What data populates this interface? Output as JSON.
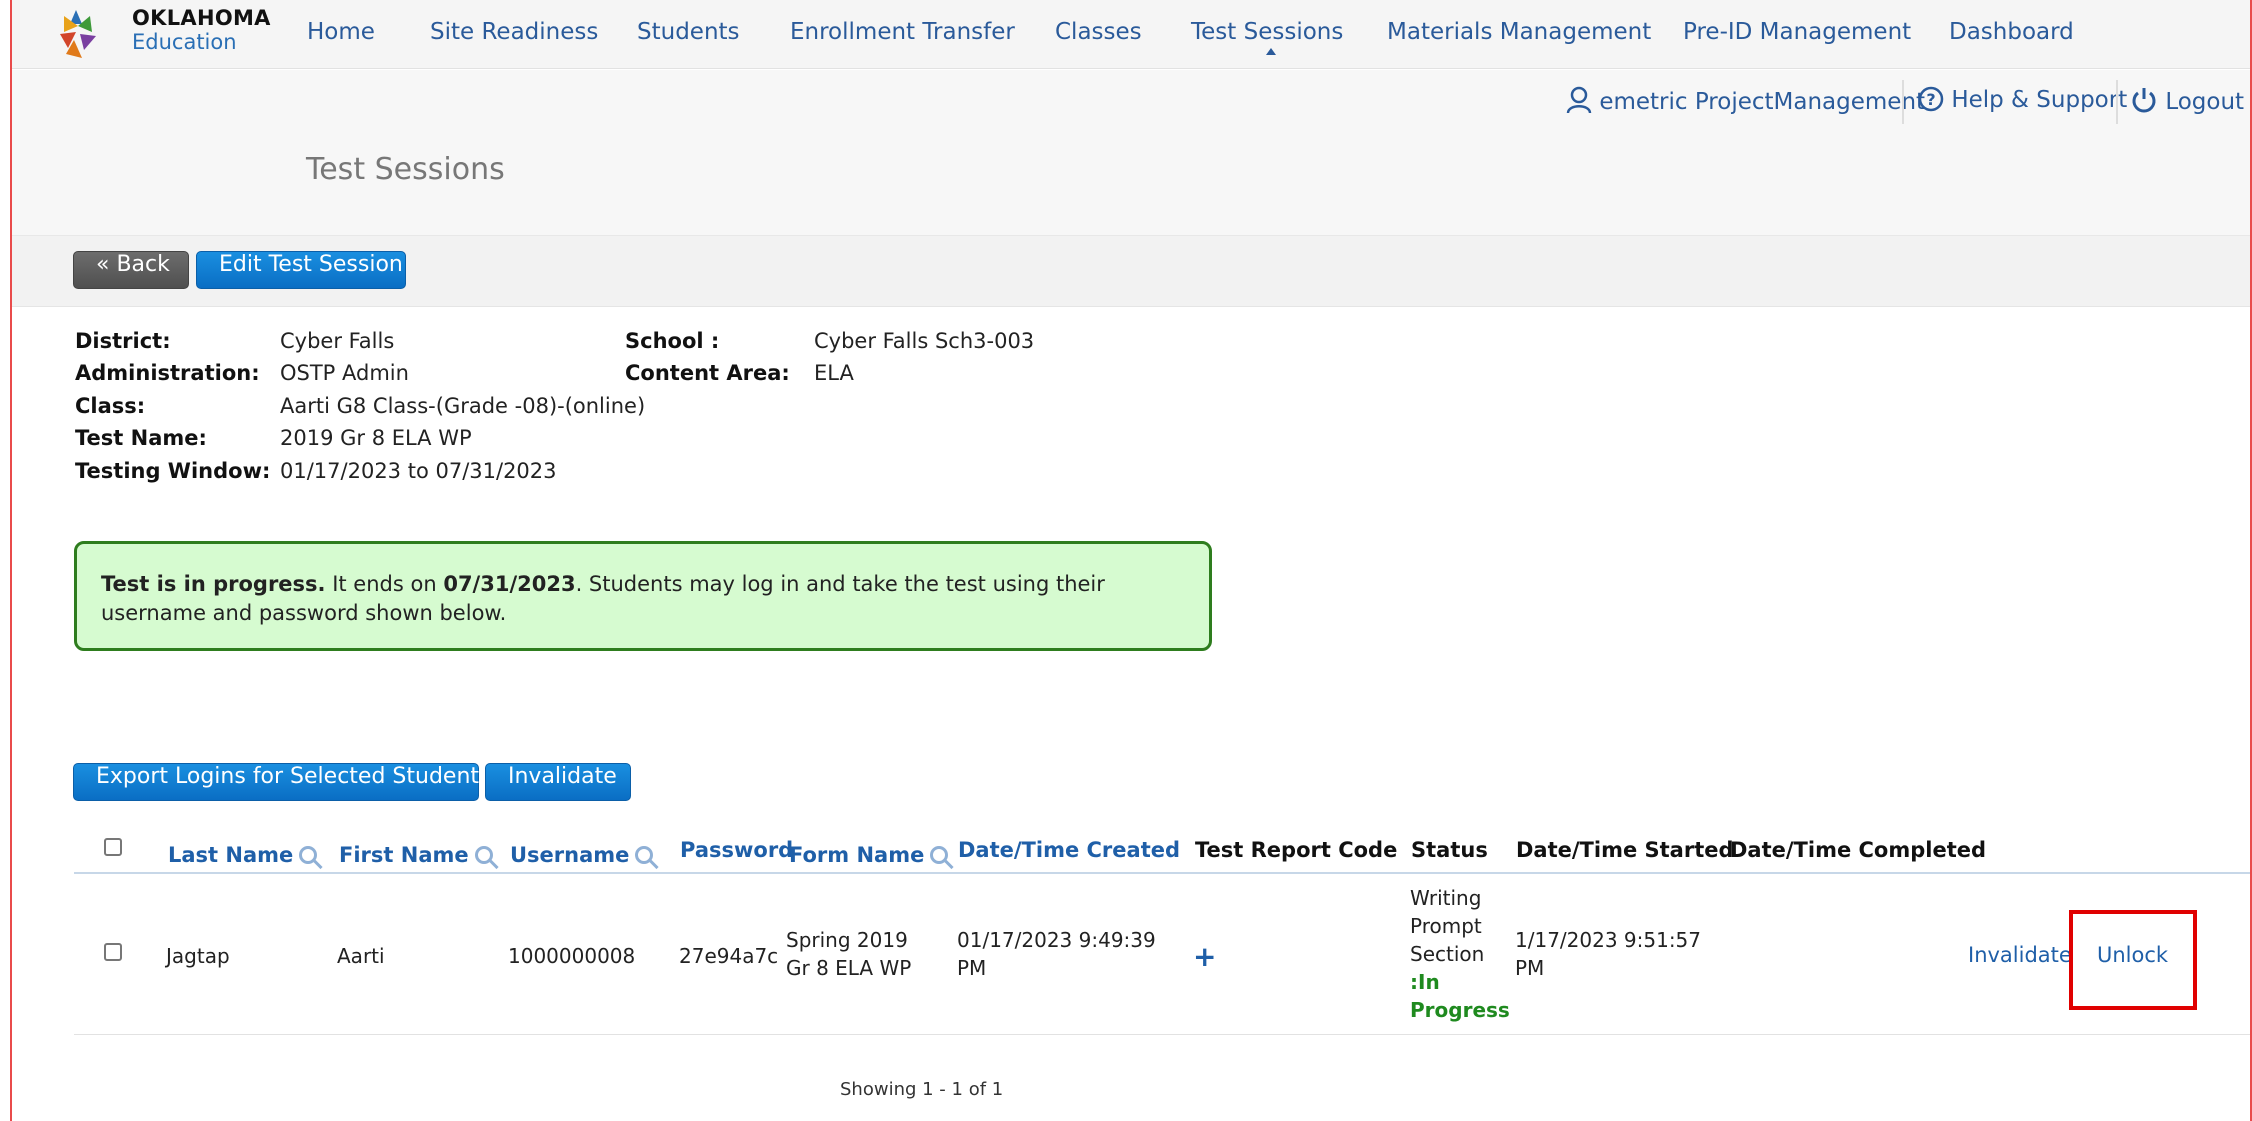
{
  "nav": {
    "logo_line1": "OKLAHOMA",
    "logo_line2": "Education",
    "items": [
      "Home",
      "Site Readiness",
      "Students",
      "Enrollment Transfer",
      "Classes",
      "Test Sessions",
      "Materials Management",
      "Pre-ID Management",
      "Dashboard"
    ],
    "active": "Test Sessions"
  },
  "userbar": {
    "user": "emetric ProjectManagement",
    "help": "Help & Support",
    "logout": "Logout"
  },
  "page_title": "Test Sessions",
  "buttons": {
    "back": "« Back",
    "edit": "Edit Test Session",
    "export": "Export Logins for Selected Students",
    "invalidate": "Invalidate"
  },
  "details": {
    "district_label": "District",
    "district": "Cyber Falls",
    "school_label": "School",
    "school": "Cyber Falls Sch3-003",
    "administration_label": "Administration",
    "administration": "OSTP Admin",
    "content_area_label": "Content Area",
    "content_area": "ELA",
    "class_label": "Class",
    "class": "Aarti G8 Class-(Grade -08)-(online)",
    "test_name_label": "Test Name",
    "test_name": "2019 Gr 8 ELA WP",
    "testing_window_label": "Testing Window",
    "testing_window": "01/17/2023 to 07/31/2023"
  },
  "alert": {
    "strong1": "Test is in progress.",
    "text1": " It ends on ",
    "strong2": "07/31/2023",
    "text2": ". Students may log in and take the test using their username and password shown below."
  },
  "table": {
    "headers": {
      "last_name": "Last Name",
      "first_name": "First Name",
      "username": "Username",
      "password": "Password",
      "form_name": "Form Name",
      "created": "Date/Time Created",
      "report_code": "Test Report Code",
      "status": "Status",
      "started": "Date/Time Started",
      "completed": "Date/Time Completed"
    },
    "rows": [
      {
        "last_name": "Jagtap",
        "first_name": "Aarti",
        "username": "1000000008",
        "password": "27e94a7c",
        "form_name": "Spring 2019 Gr 8 ELA WP",
        "created": "01/17/2023 9:49:39 PM",
        "report_code": "+",
        "status_prefix": "Writing Prompt Section",
        "status_value": ":In Progress",
        "started": "1/17/2023 9:51:57 PM",
        "completed": "",
        "action1": "Invalidate",
        "action2": "Unlock"
      }
    ]
  },
  "pagination": "Showing 1 - 1 of 1",
  "colors": {
    "accent": "#0a6ec4",
    "alert_bg": "#d6fbd0",
    "alert_border": "#2e7d1e",
    "highlight": "#e00000"
  }
}
